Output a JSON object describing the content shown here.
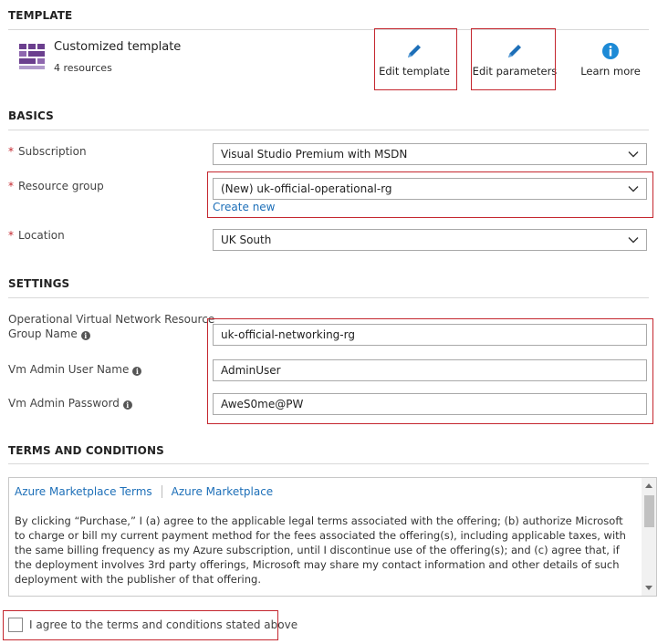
{
  "template": {
    "header": "TEMPLATE",
    "tile_title": "Customized template",
    "tile_subtitle": "4 resources",
    "tile_icon": "template-grid-icon",
    "actions": {
      "edit_template": "Edit template",
      "edit_parameters": "Edit parameters",
      "learn_more": "Learn more"
    }
  },
  "basics": {
    "header": "BASICS",
    "required_marker": "*",
    "subscription_label": "Subscription",
    "subscription_value": "Visual Studio Premium with MSDN",
    "resource_group_label": "Resource group",
    "resource_group_value": "(New) uk-official-operational-rg",
    "create_new_link": "Create new",
    "location_label": "Location",
    "location_value": "UK South"
  },
  "settings": {
    "header": "SETTINGS",
    "rg_name_label_line1": "Operational Virtual Network Resource",
    "rg_name_label_line2": "Group Name",
    "rg_name_value": "uk-official-networking-rg",
    "admin_user_label": "Vm Admin User Name",
    "admin_user_value": "AdminUser",
    "admin_password_label": "Vm Admin Password",
    "admin_password_value": "AweS0me@PW"
  },
  "terms": {
    "header": "TERMS AND CONDITIONS",
    "link_terms": "Azure Marketplace Terms",
    "link_marketplace": "Azure Marketplace",
    "body": "By clicking “Purchase,” I (a) agree to the applicable legal terms associated with the offering; (b) authorize Microsoft to charge or bill my current payment method for the fees associated the offering(s), including applicable taxes, with the same billing frequency as my Azure subscription, until I discontinue use of the offering(s); and (c) agree that, if the deployment involves 3rd party offerings, Microsoft may share my contact information and other details of such deployment with the publisher of that offering.",
    "agree_label": "I agree to the terms and conditions stated above"
  },
  "colors": {
    "accent_blue": "#1d6fb8",
    "highlight_red": "#c4262e",
    "tile_purple": "#6b3f8e"
  }
}
